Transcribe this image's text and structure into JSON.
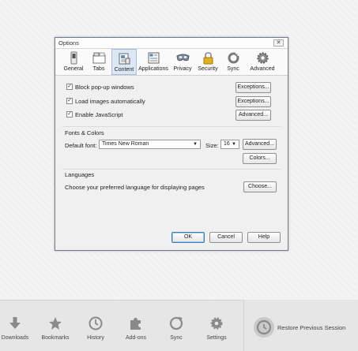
{
  "dialog": {
    "title": "Options",
    "close_label": "✕",
    "tabs": [
      {
        "label": "General",
        "icon": "switch-icon"
      },
      {
        "label": "Tabs",
        "icon": "tabs-icon"
      },
      {
        "label": "Content",
        "icon": "content-icon"
      },
      {
        "label": "Applications",
        "icon": "applications-icon"
      },
      {
        "label": "Privacy",
        "icon": "mask-icon"
      },
      {
        "label": "Security",
        "icon": "lock-icon"
      },
      {
        "label": "Sync",
        "icon": "sync-icon"
      },
      {
        "label": "Advanced",
        "icon": "gear-icon"
      }
    ],
    "active_tab": "Content",
    "content": {
      "popups_label": "Block pop-up windows",
      "popups_checked": true,
      "images_label": "Load images automatically",
      "images_checked": true,
      "js_label": "Enable JavaScript",
      "js_checked": true,
      "exceptions1_label": "Exceptions...",
      "exceptions2_label": "Exceptions...",
      "advanced1_label": "Advanced...",
      "fonts_header": "Fonts & Colors",
      "default_font_label": "Default font:",
      "default_font_value": "Times New Roman",
      "size_label": "Size:",
      "size_value": "16",
      "advanced2_label": "Advanced...",
      "colors_label": "Colors...",
      "languages_header": "Languages",
      "languages_text": "Choose your preferred language for displaying pages",
      "choose_label": "Choose..."
    },
    "footer": {
      "ok_label": "OK",
      "cancel_label": "Cancel",
      "help_label": "Help"
    }
  },
  "bottombar": {
    "items": [
      {
        "label": "Downloads",
        "icon": "download-icon"
      },
      {
        "label": "Bookmarks",
        "icon": "star-icon"
      },
      {
        "label": "History",
        "icon": "clock-icon"
      },
      {
        "label": "Add-ons",
        "icon": "puzzle-icon"
      },
      {
        "label": "Sync",
        "icon": "sync-icon"
      },
      {
        "label": "Settings",
        "icon": "gear-icon"
      }
    ],
    "restore_label": "Restore Previous Session"
  },
  "colors": {
    "accent": "#3c7fb1",
    "active_tab_bg": "#dbe7f5",
    "bottom_icon": "#8a8a8a"
  }
}
